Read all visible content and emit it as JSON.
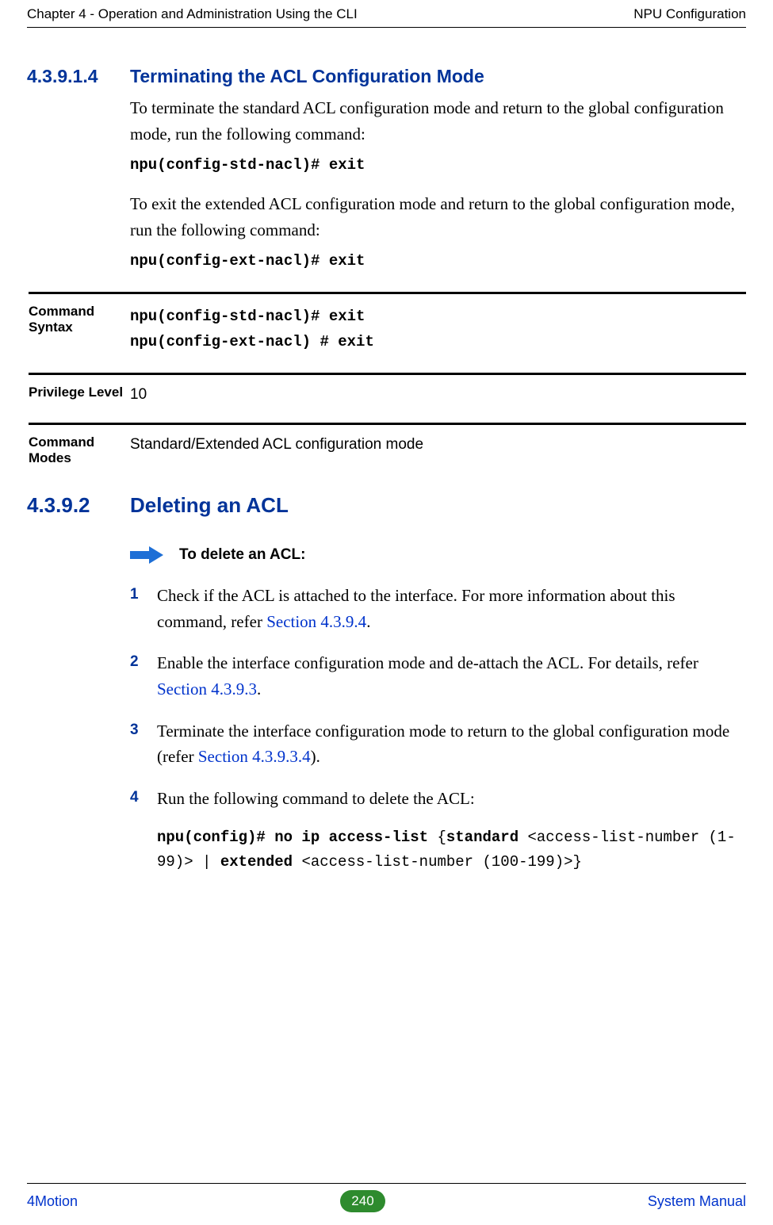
{
  "header": {
    "left": "Chapter 4 - Operation and Administration Using the CLI",
    "right": "NPU Configuration"
  },
  "sec1": {
    "num": "4.3.9.1.4",
    "title": "Terminating the ACL Configuration Mode",
    "p1": "To terminate the standard ACL configuration mode and return to the global configuration mode, run the following command:",
    "cmd1": "npu(config-std-nacl)# exit",
    "p2": "To exit the extended ACL configuration mode and return to the global configuration mode, run the following command:",
    "cmd2": "npu(config-ext-nacl)# exit"
  },
  "info": {
    "rows": [
      {
        "label": "Command Syntax",
        "mono": [
          "npu(config-std-nacl)# exit",
          "npu(config-ext-nacl) # exit"
        ]
      },
      {
        "label": "Privilege Level",
        "text": "10"
      },
      {
        "label": "Command Modes",
        "text": "Standard/Extended ACL configuration mode"
      }
    ]
  },
  "sec2": {
    "num": "4.3.9.2",
    "title": "Deleting an ACL",
    "procTitle": "To delete an ACL:",
    "steps": [
      {
        "num": "1",
        "pre": "Check if the ACL is attached to the interface. For more information about this command, refer ",
        "link": "Section 4.3.9.4",
        "post": "."
      },
      {
        "num": "2",
        "pre": "Enable the interface configuration mode and de-attach the ACL. For details, refer ",
        "link": "Section 4.3.9.3",
        "post": "."
      },
      {
        "num": "3",
        "pre": "Terminate the interface configuration mode to return to the global configuration mode (refer ",
        "link": "Section 4.3.9.3.4",
        "post": ")."
      },
      {
        "num": "4",
        "pre": "Run the following command to delete the ACL:",
        "link": "",
        "post": ""
      }
    ],
    "finalCmd": {
      "b1": "npu(config)# no ip access-list ",
      "t1": "{",
      "b2": "standard",
      "t2": " <access-list-number (1-99)> | ",
      "b3": "extended",
      "t3": " <access-list-number (100-199)>}"
    }
  },
  "footer": {
    "left": "4Motion",
    "page": "240",
    "right": "System Manual"
  }
}
